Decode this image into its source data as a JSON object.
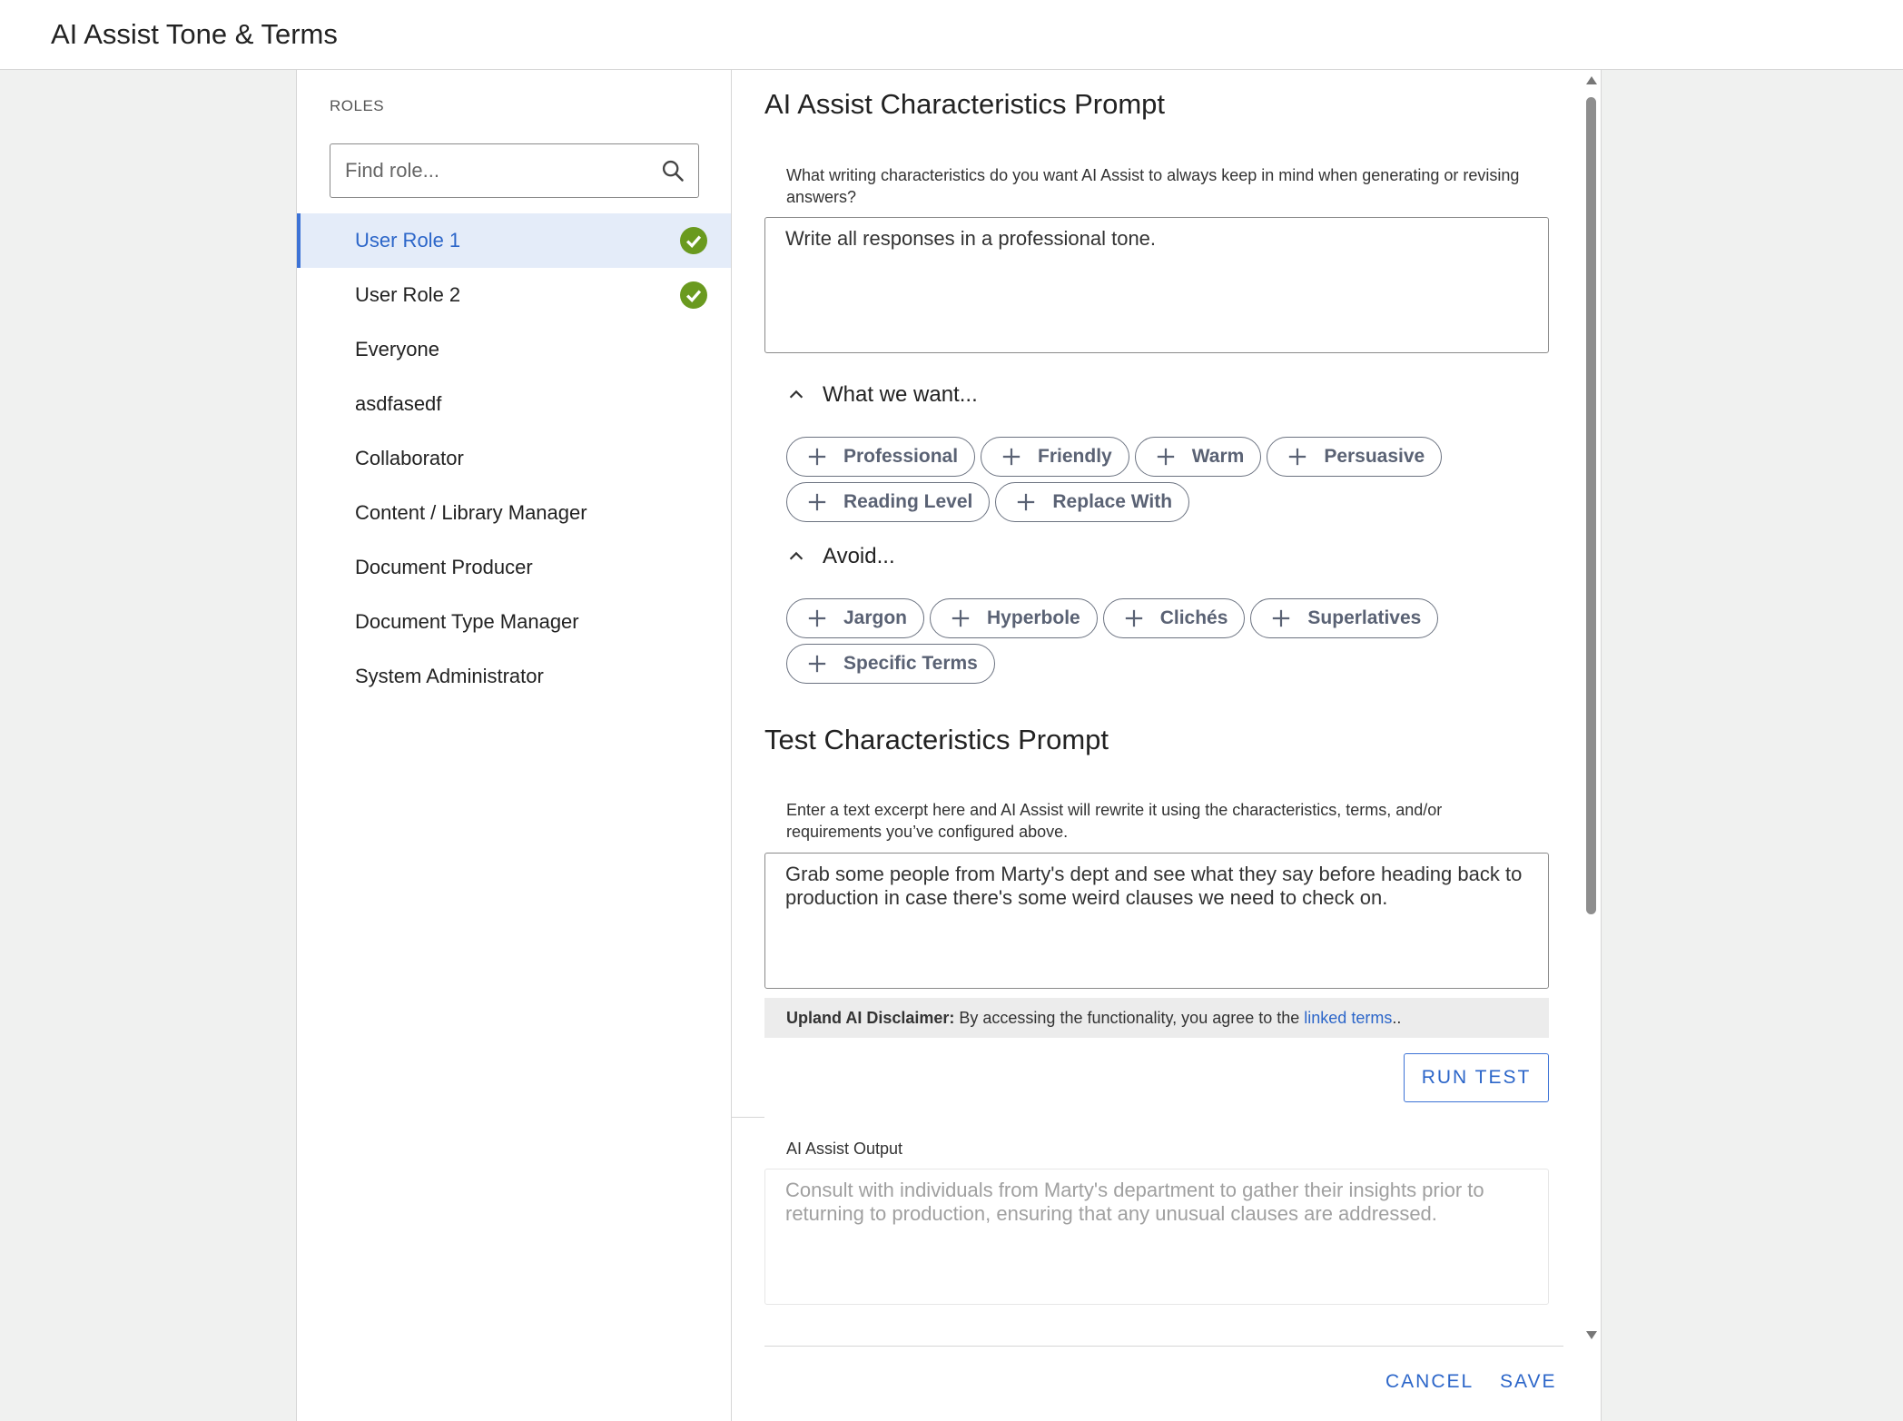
{
  "header": {
    "title": "AI Assist Tone & Terms"
  },
  "sidebar": {
    "heading": "ROLES",
    "search_placeholder": "Find role...",
    "roles": [
      {
        "label": "User Role 1",
        "active": true,
        "configured": true
      },
      {
        "label": "User Role 2",
        "active": false,
        "configured": true
      },
      {
        "label": "Everyone",
        "active": false,
        "configured": false
      },
      {
        "label": "asdfasedf",
        "active": false,
        "configured": false
      },
      {
        "label": "Collaborator",
        "active": false,
        "configured": false
      },
      {
        "label": "Content / Library Manager",
        "active": false,
        "configured": false
      },
      {
        "label": "Document Producer",
        "active": false,
        "configured": false
      },
      {
        "label": "Document Type Manager",
        "active": false,
        "configured": false
      },
      {
        "label": "System Administrator",
        "active": false,
        "configured": false
      }
    ]
  },
  "characteristics": {
    "title": "AI Assist Characteristics Prompt",
    "description": "What writing characteristics do you want AI Assist to always keep in mind when generating or revising answers?",
    "value": "Write all responses in a professional tone.",
    "want_label": "What we want...",
    "want_chips": [
      [
        "Professional",
        "Friendly",
        "Warm",
        "Persuasive"
      ],
      [
        "Reading Level",
        "Replace With"
      ]
    ],
    "avoid_label": "Avoid...",
    "avoid_chips": [
      [
        "Jargon",
        "Hyperbole",
        "Clichés",
        "Superlatives"
      ],
      [
        "Specific Terms"
      ]
    ]
  },
  "test": {
    "title": "Test Characteristics Prompt",
    "description": "Enter a text excerpt here and AI Assist will rewrite it using the characteristics, terms, and/or requirements you’ve configured above.",
    "value": "Grab some people from Marty's dept and see what they say before heading back to production in case there's some weird clauses we need to check on.",
    "disclaimer_bold": "Upland AI Disclaimer:",
    "disclaimer_text": " By accessing the functionality, you agree to the ",
    "disclaimer_link": "linked terms",
    "disclaimer_end": "..",
    "run_label": "RUN TEST",
    "output_label": "AI Assist Output",
    "output_value": "Consult with individuals from Marty's department to gather their insights prior to returning to production, ensuring that any unusual clauses are addressed."
  },
  "footer": {
    "cancel_label": "CANCEL",
    "save_label": "SAVE"
  },
  "colors": {
    "accent": "#2c66c9",
    "check": "#6a9a1f",
    "active_bg": "#e4ecf9"
  }
}
